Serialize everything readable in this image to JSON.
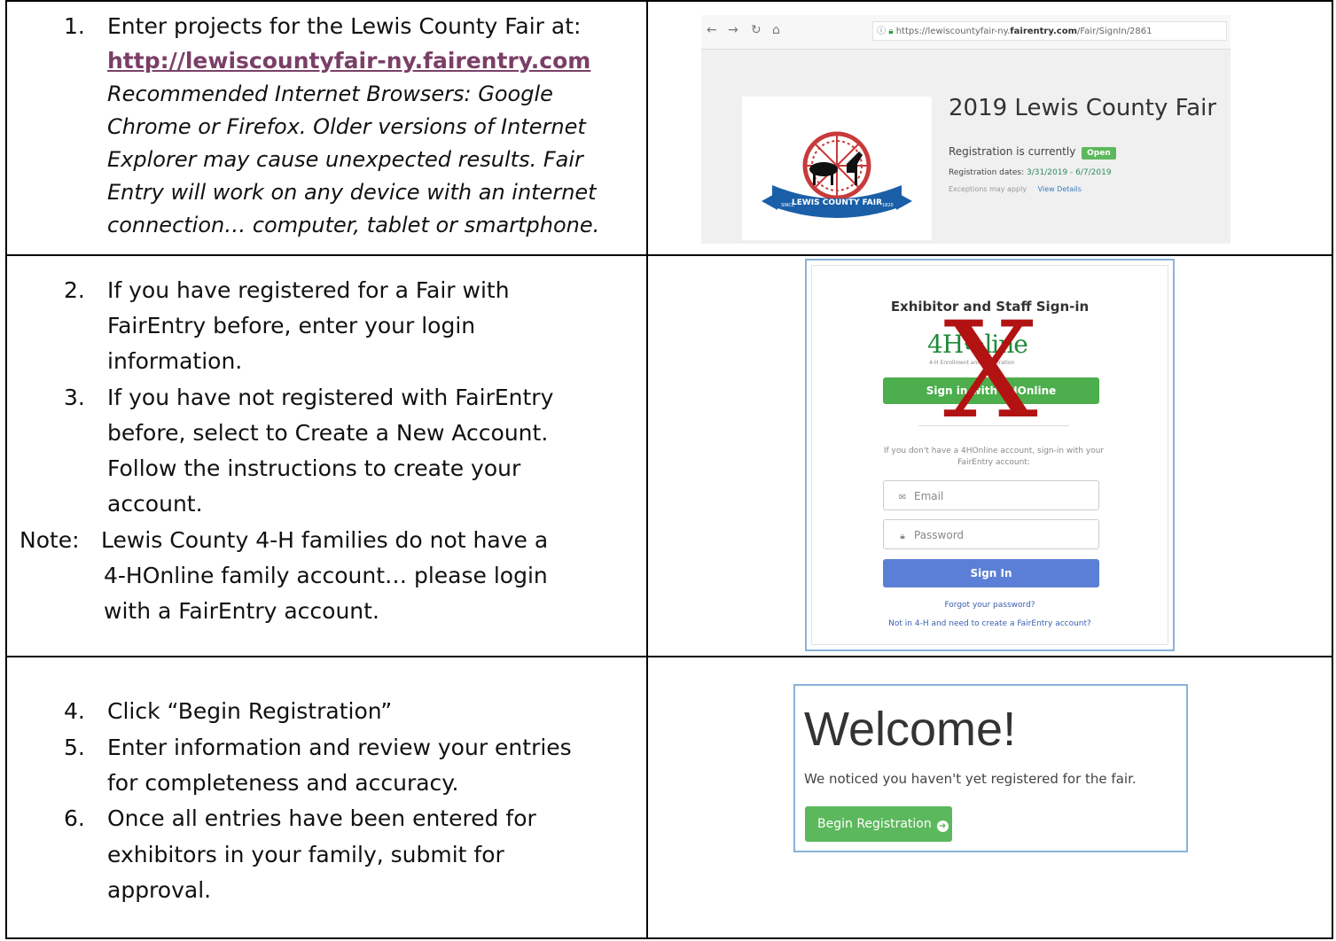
{
  "steps": {
    "s1_num": "1.",
    "s1_text": "Enter projects for the Lewis County Fair at:",
    "s1_link": "http://lewiscountyfair-ny.fairentry.com",
    "s1_note_l1": "Recommended Internet Browsers: Google",
    "s1_note_l2": "Chrome or Firefox.  Older versions of Internet",
    "s1_note_l3": "Explorer may cause unexpected results.  Fair",
    "s1_note_l4": "Entry will work on any device with an internet",
    "s1_note_l5": "connection… computer, tablet or smartphone.",
    "s2_num": "2.",
    "s2_l1": "If you have registered for a Fair with",
    "s2_l2": "FairEntry before, enter your login",
    "s2_l3": "information.",
    "s3_num": "3.",
    "s3_l1": "If you have not registered with FairEntry",
    "s3_l2": "before, select to Create a New Account.",
    "s3_l3": "Follow the instructions to create your",
    "s3_l4": "account.",
    "note_label": "Note:",
    "note_l1": "Lewis County 4-H families do not have a",
    "note_l2": "4-HOnline family account… please login",
    "note_l3": "with a FairEntry account.",
    "s4_num": "4.",
    "s4_l1": "Click “Begin Registration”",
    "s5_num": "5.",
    "s5_l1": "Enter information and review your entries",
    "s5_l2": "for completeness and accuracy.",
    "s6_num": "6.",
    "s6_l1": "Once all entries have been entered for",
    "s6_l2": "exhibitors in your family, submit for",
    "s6_l3": "approval."
  },
  "shot1": {
    "url_prefix": "https://lewiscountyfair-ny.",
    "url_bold": "fairentry.com",
    "url_suffix": "/Fair/SignIn/2861",
    "title": "2019 Lewis County Fair",
    "reg_label": "Registration is currently",
    "reg_status": "Open",
    "dates_label": "Registration dates:",
    "dates_value": "3/31/2019 - 6/7/2019",
    "exceptions": "Exceptions may apply",
    "view_details": "View Details",
    "logo_banner": "LEWIS COUNTY FAIR",
    "logo_since": "SINCE",
    "logo_year": "1820"
  },
  "shot2": {
    "heading": "Exhibitor and Staff Sign-in",
    "brand": "4H",
    "brand_tail": "line",
    "brand_sub": "4-H Enrollment and Registration",
    "btn_4h": "Sign in with 4HOnline",
    "note": "If you don't have a 4HOnline account, sign-in with your FairEntry account:",
    "email_placeholder": "Email",
    "password_placeholder": "Password",
    "signin": "Sign In",
    "forgot": "Forgot your password?",
    "create": "Not in 4-H and need to create a FairEntry account?",
    "x_mark": "X"
  },
  "shot3": {
    "welcome": "Welcome!",
    "message": "We noticed you haven't yet registered for the fair.",
    "button": "Begin Registration"
  },
  "colors": {
    "link": "#7a3f66",
    "open_badge": "#5cb85c",
    "green_button": "#4cae4c",
    "blue_button": "#5b7fd6",
    "x_mark": "#b31212",
    "brand_green": "#1f8a3b"
  },
  "icons": [
    "back-arrow-icon",
    "forward-arrow-icon",
    "reload-icon",
    "home-icon",
    "info-icon",
    "lock-icon",
    "email-icon",
    "password-lock-icon",
    "arrow-circle-right-icon",
    "clover-icon"
  ]
}
